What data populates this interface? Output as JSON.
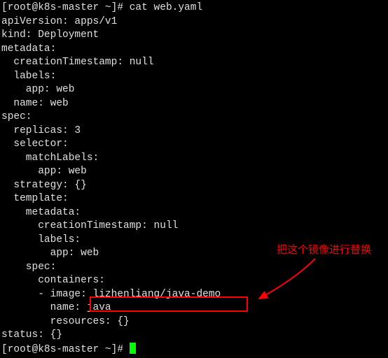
{
  "prompt1_full": "[root@k8s-master ~]# ",
  "command1": "cat web.yaml",
  "yaml": {
    "l1": "apiVersion: apps/v1",
    "l2": "kind: Deployment",
    "l3": "metadata:",
    "l4": "  creationTimestamp: null",
    "l5": "  labels:",
    "l6": "    app: web",
    "l7": "  name: web",
    "l8": "spec:",
    "l9": "  replicas: 3",
    "l10": "  selector:",
    "l11": "    matchLabels:",
    "l12": "      app: web",
    "l13": "  strategy: {}",
    "l14": "  template:",
    "l15": "    metadata:",
    "l16": "      creationTimestamp: null",
    "l17": "      labels:",
    "l18": "        app: web",
    "l19": "    spec:",
    "l20": "      containers:",
    "l21": "      - image: lizhenliang/java-demo",
    "l22": "        name: java",
    "l23": "        resources: {}",
    "l24": "status: {}"
  },
  "prompt2_full": "[root@k8s-master ~]# ",
  "annotation_text": "把这个镜像进行替换",
  "highlighted_value": "lizhenliang/java-demo"
}
